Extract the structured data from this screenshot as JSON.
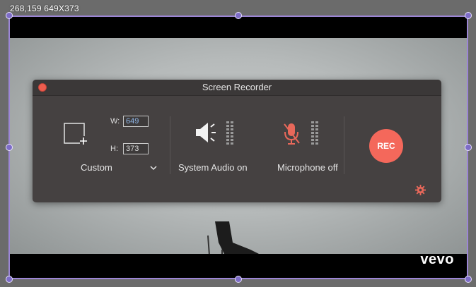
{
  "overlay": {
    "coord_label": "268,159 649X373"
  },
  "video": {
    "watermark": "vevo"
  },
  "recorder": {
    "title": "Screen Recorder",
    "region": {
      "width_label": "W:",
      "height_label": "H:",
      "width_value": "649",
      "height_value": "373",
      "mode_label": "Custom"
    },
    "system_audio": {
      "label": "System Audio on",
      "level": 0.0
    },
    "microphone": {
      "label": "Microphone off",
      "level": 0.0
    },
    "rec_label": "REC",
    "icons": {
      "close": "close-icon",
      "region": "region-select-icon",
      "dropdown": "chevron-down-icon",
      "speaker": "speaker-icon",
      "microphone": "microphone-muted-icon",
      "settings": "gear-icon"
    }
  },
  "colors": {
    "frame": "#9c86d6",
    "handle": "#7d6cc7",
    "rec": "#f4685b",
    "mic_muted": "#e8685a",
    "gear": "#e8685a",
    "panel": "#454141"
  }
}
